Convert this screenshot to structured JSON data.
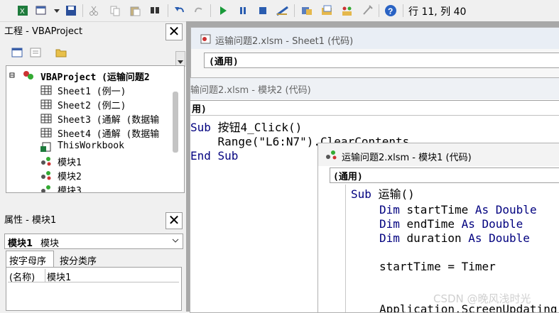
{
  "toolbar": {
    "status": "行 11, 列 40"
  },
  "project_panel": {
    "title": "工程 - VBAProject",
    "root": "VBAProject (运输问题2",
    "items": [
      {
        "label": "Sheet1 (例一)"
      },
      {
        "label": "Sheet2 (例二)"
      },
      {
        "label": "Sheet3 (通解 (数据输"
      },
      {
        "label": "Sheet4 (通解 (数据输"
      },
      {
        "label": "ThisWorkbook"
      },
      {
        "label": "模块1"
      },
      {
        "label": "模块2"
      },
      {
        "label": "模块3"
      }
    ]
  },
  "properties_panel": {
    "title": "属性 - 模块1",
    "object_bold": "模块1",
    "object_type": "模块",
    "tabs": [
      "按字母序",
      "按分类序"
    ],
    "row_name": "(名称)",
    "row_value": "模块1"
  },
  "windows": {
    "sheet1": {
      "title": "运输问题2.xlsm - Sheet1 (代码)",
      "combo": "(通用)"
    },
    "module2": {
      "title": "输问题2.xlsm - 模块2 (代码)",
      "combo": "用)",
      "lines": {
        "l1_kw": "Sub",
        "l1_rest": " 按钮4_Click()",
        "l2": "    Range(\"L6:N7\").ClearContents",
        "l3": "End Sub"
      }
    },
    "module1": {
      "title": "运输问题2.xlsm - 模块1 (代码)",
      "combo": "(通用)",
      "lines": {
        "a_kw": "Sub",
        "a_rest": " 运输()",
        "b_kw1": "Dim",
        "b_mid": " startTime ",
        "b_kw2": "As Double",
        "c_kw1": "Dim",
        "c_mid": " endTime ",
        "c_kw2": "As Double",
        "d_kw1": "Dim",
        "d_mid": " duration ",
        "d_kw2": "As Double",
        "e": "startTime = Timer",
        "f": "Application.ScreenUpdating"
      }
    }
  },
  "watermark": "CSDN @晚风浅时光"
}
